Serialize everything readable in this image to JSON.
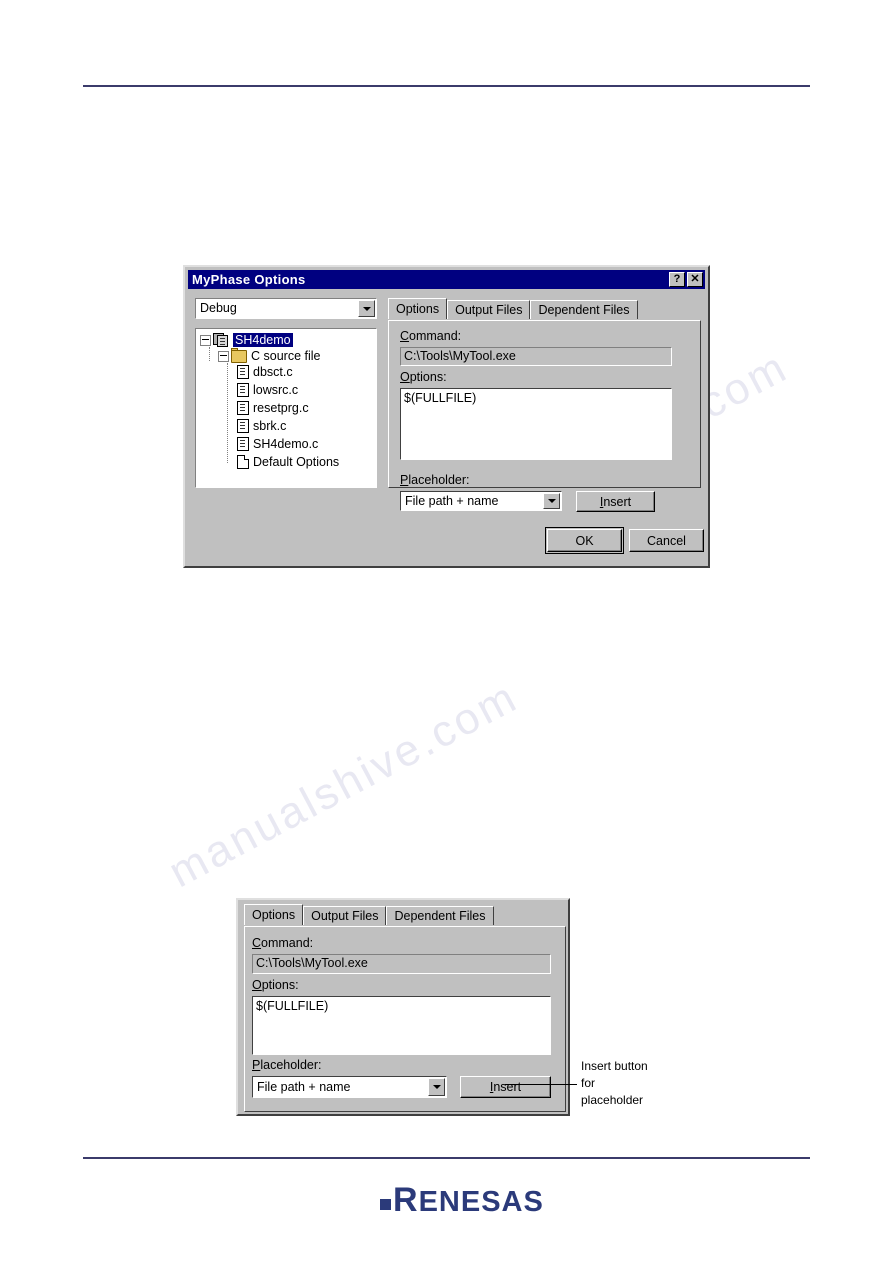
{
  "page": {
    "header_rule": "",
    "footer_rule": "",
    "logo_text": "ENESAS",
    "logo_cap": "R"
  },
  "watermark": {
    "line1": "manualshive.com",
    "line2": "manualshive.com"
  },
  "main_dialog": {
    "title": "MyPhase  Options",
    "title_buttons": [
      {
        "name": "help-button",
        "glyph": "?"
      },
      {
        "name": "close-button",
        "glyph": "✕"
      }
    ],
    "config_combo": {
      "value": "Debug",
      "arrow": "chevron-down-icon"
    },
    "tree": {
      "root": {
        "label": "SH4demo",
        "selected": true,
        "icon": "project-icon"
      },
      "folder": {
        "label": "C source file",
        "icon": "folder-icon"
      },
      "files": [
        {
          "label": "dbsct.c",
          "icon": "c-file-icon"
        },
        {
          "label": "lowsrc.c",
          "icon": "c-file-icon"
        },
        {
          "label": "resetprg.c",
          "icon": "c-file-icon"
        },
        {
          "label": "sbrk.c",
          "icon": "c-file-icon"
        },
        {
          "label": "SH4demo.c",
          "icon": "c-file-icon"
        },
        {
          "label": "Default Options",
          "icon": "blank-file-icon"
        }
      ]
    },
    "tabs": [
      {
        "label": "Options",
        "active": true
      },
      {
        "label": "Output Files",
        "active": false
      },
      {
        "label": "Dependent Files",
        "active": false
      }
    ],
    "command": {
      "label": "Command:",
      "label_mnemonic": "C",
      "label_rest": "ommand:",
      "value": "C:\\Tools\\MyTool.exe"
    },
    "options": {
      "label_mnemonic": "O",
      "label_rest": "ptions:",
      "value": "$(FULLFILE)"
    },
    "placeholder": {
      "label_mnemonic": "P",
      "label_rest": "laceholder:",
      "value": "File path + name"
    },
    "insert_button": {
      "mnemonic": "I",
      "rest": "nsert"
    },
    "ok_button": "OK",
    "cancel_button": "Cancel"
  },
  "detail_figure": {
    "tabs": [
      {
        "label": "Options",
        "active": true
      },
      {
        "label": "Output Files",
        "active": false
      },
      {
        "label": "Dependent Files",
        "active": false
      }
    ],
    "command": {
      "label_mnemonic": "C",
      "label_rest": "ommand:",
      "value": "C:\\Tools\\MyTool.exe"
    },
    "options": {
      "label_mnemonic": "O",
      "label_rest": "ptions:",
      "value": "$(FULLFILE)"
    },
    "placeholder": {
      "label_mnemonic": "P",
      "label_rest": "laceholder:",
      "value": "File path + name"
    },
    "insert_button": {
      "mnemonic": "I",
      "rest": "nsert"
    },
    "annotation": {
      "line1": "Insert button",
      "line2": "for",
      "line3": "placeholder"
    }
  }
}
